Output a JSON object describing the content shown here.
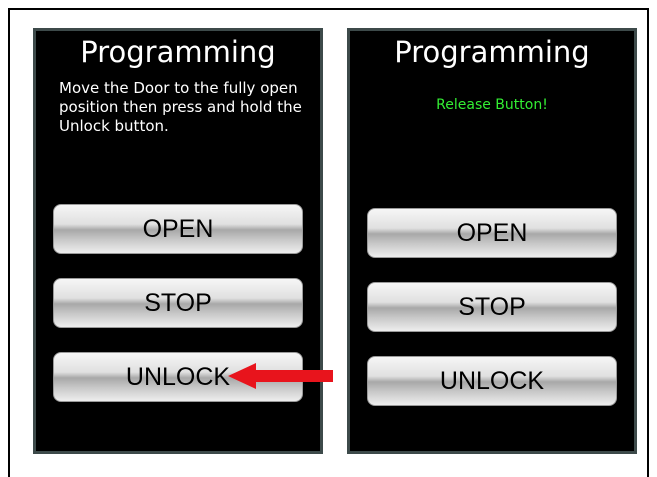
{
  "left_panel": {
    "title": "Programming",
    "instruction": "Move the Door to the fully open position then press and hold the Unlock button.",
    "buttons": {
      "open": "OPEN",
      "stop": "STOP",
      "unlock": "UNLOCK"
    }
  },
  "right_panel": {
    "title": "Programming",
    "status": "Release Button!",
    "buttons": {
      "open": "OPEN",
      "stop": "STOP",
      "unlock": "UNLOCK"
    }
  },
  "colors": {
    "screen_bg": "#000000",
    "status_green": "#33ee33",
    "arrow_red": "#e8141c"
  },
  "icons": {
    "pointer": "red-arrow-left-icon"
  }
}
